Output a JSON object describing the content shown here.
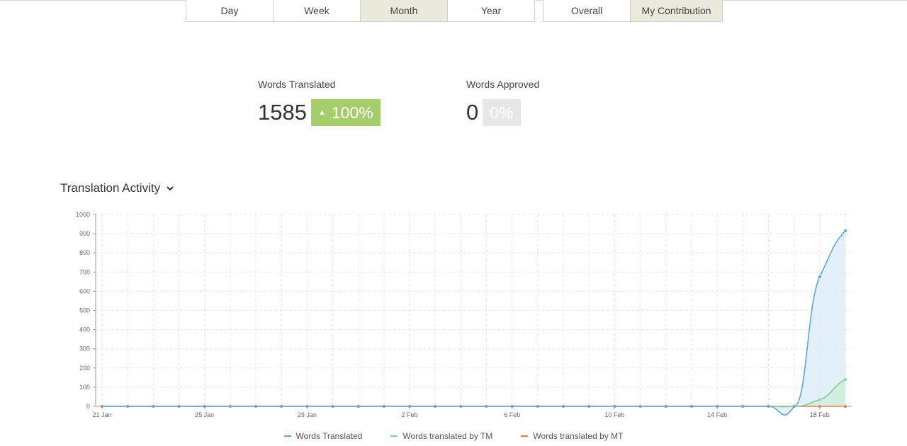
{
  "period_tabs": [
    {
      "label": "Day",
      "active": false
    },
    {
      "label": "Week",
      "active": false
    },
    {
      "label": "Month",
      "active": true
    },
    {
      "label": "Year",
      "active": false
    }
  ],
  "scope_tabs": [
    {
      "label": "Overall",
      "active": false
    },
    {
      "label": "My Contribution",
      "active": true
    }
  ],
  "stats": {
    "translated": {
      "label": "Words Translated",
      "value": "1585",
      "change": "100%",
      "trend_icon": "triangle-up-icon",
      "color": "#a6cd6b"
    },
    "approved": {
      "label": "Words Approved",
      "value": "0",
      "change": "0%",
      "color": "#e7e7e7"
    }
  },
  "chart_header": {
    "title": "Translation Activity",
    "icon": "chevron-down-icon"
  },
  "chart_data": {
    "type": "area",
    "title": "Translation Activity",
    "xlabel": "",
    "ylabel": "",
    "x_start": "2024-01-21",
    "x": [
      "21 Jan",
      "22 Jan",
      "23 Jan",
      "24 Jan",
      "25 Jan",
      "26 Jan",
      "27 Jan",
      "28 Jan",
      "29 Jan",
      "30 Jan",
      "31 Jan",
      "1 Feb",
      "2 Feb",
      "3 Feb",
      "4 Feb",
      "5 Feb",
      "6 Feb",
      "7 Feb",
      "8 Feb",
      "9 Feb",
      "10 Feb",
      "11 Feb",
      "12 Feb",
      "13 Feb",
      "14 Feb",
      "15 Feb",
      "16 Feb",
      "17 Feb",
      "18 Feb",
      "19 Feb"
    ],
    "x_tick_labels": [
      "21 Jan",
      "25 Jan",
      "29 Jan",
      "2 Feb",
      "6 Feb",
      "10 Feb",
      "14 Feb",
      "18 Feb"
    ],
    "x_tick_indices": [
      0,
      4,
      8,
      12,
      16,
      20,
      24,
      28
    ],
    "ylim": [
      0,
      1000
    ],
    "y_ticks": [
      0,
      100,
      200,
      300,
      400,
      500,
      600,
      700,
      800,
      900,
      1000
    ],
    "grid": true,
    "legend_position": "bottom",
    "series": [
      {
        "name": "Words Translated",
        "color": "#5ea6d6",
        "fill": "#dcebf8",
        "values": [
          0,
          0,
          0,
          0,
          0,
          0,
          0,
          0,
          0,
          0,
          0,
          0,
          0,
          0,
          0,
          0,
          0,
          0,
          0,
          0,
          0,
          0,
          0,
          0,
          0,
          0,
          0,
          0,
          675,
          915
        ]
      },
      {
        "name": "Words translated by TM",
        "color": "#7dcf9d",
        "fill": "#cdeedb",
        "values": [
          0,
          0,
          0,
          0,
          0,
          0,
          0,
          0,
          0,
          0,
          0,
          0,
          0,
          0,
          0,
          0,
          0,
          0,
          0,
          0,
          0,
          0,
          0,
          0,
          0,
          0,
          0,
          0,
          35,
          140
        ]
      },
      {
        "name": "Words translated by MT",
        "color": "#e07a4f",
        "fill": "none",
        "values": [
          0,
          0,
          0,
          0,
          0,
          0,
          0,
          0,
          0,
          0,
          0,
          0,
          0,
          0,
          0,
          0,
          0,
          0,
          0,
          0,
          0,
          0,
          0,
          0,
          0,
          0,
          0,
          0,
          0,
          0
        ]
      }
    ]
  }
}
